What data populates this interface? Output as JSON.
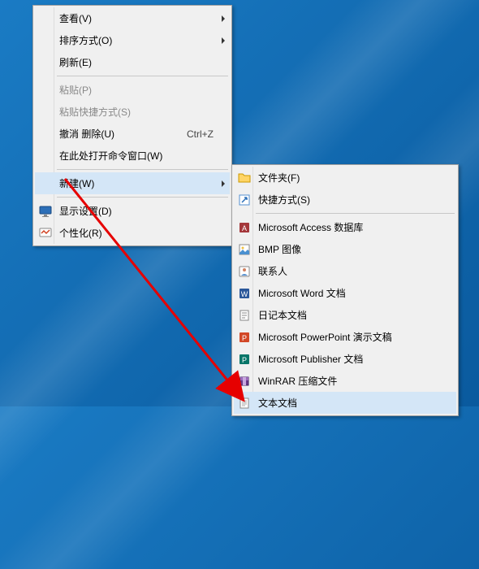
{
  "main_menu": {
    "view": "查看(V)",
    "sort": "排序方式(O)",
    "refresh": "刷新(E)",
    "paste": "粘贴(P)",
    "paste_shortcut": "粘贴快捷方式(S)",
    "undo_delete": "撤消 删除(U)",
    "undo_delete_key": "Ctrl+Z",
    "open_cmd": "在此处打开命令窗口(W)",
    "new": "新建(W)",
    "display": "显示设置(D)",
    "personalize": "个性化(R)"
  },
  "sub_menu": {
    "folder": "文件夹(F)",
    "shortcut": "快捷方式(S)",
    "access": "Microsoft Access 数据库",
    "bmp": "BMP 图像",
    "contact": "联系人",
    "word": "Microsoft Word 文档",
    "journal": "日记本文档",
    "ppt": "Microsoft PowerPoint 演示文稿",
    "publisher": "Microsoft Publisher 文档",
    "winrar": "WinRAR 压缩文件",
    "txt": "文本文档"
  },
  "icons": {
    "monitor": "display-icon",
    "personalize": "personalize-icon",
    "folder": "folder-icon",
    "shortcut": "shortcut-icon",
    "access": "access-icon",
    "bmp": "bmp-icon",
    "contact": "contact-icon",
    "word": "word-icon",
    "journal": "journal-icon",
    "ppt": "ppt-icon",
    "publisher": "publisher-icon",
    "winrar": "winrar-icon",
    "txt": "txt-icon"
  },
  "colors": {
    "hover_bg": "#d4e6f7",
    "menu_bg": "#f0f0f0",
    "disabled": "#888888",
    "annotation": "#e60000"
  }
}
